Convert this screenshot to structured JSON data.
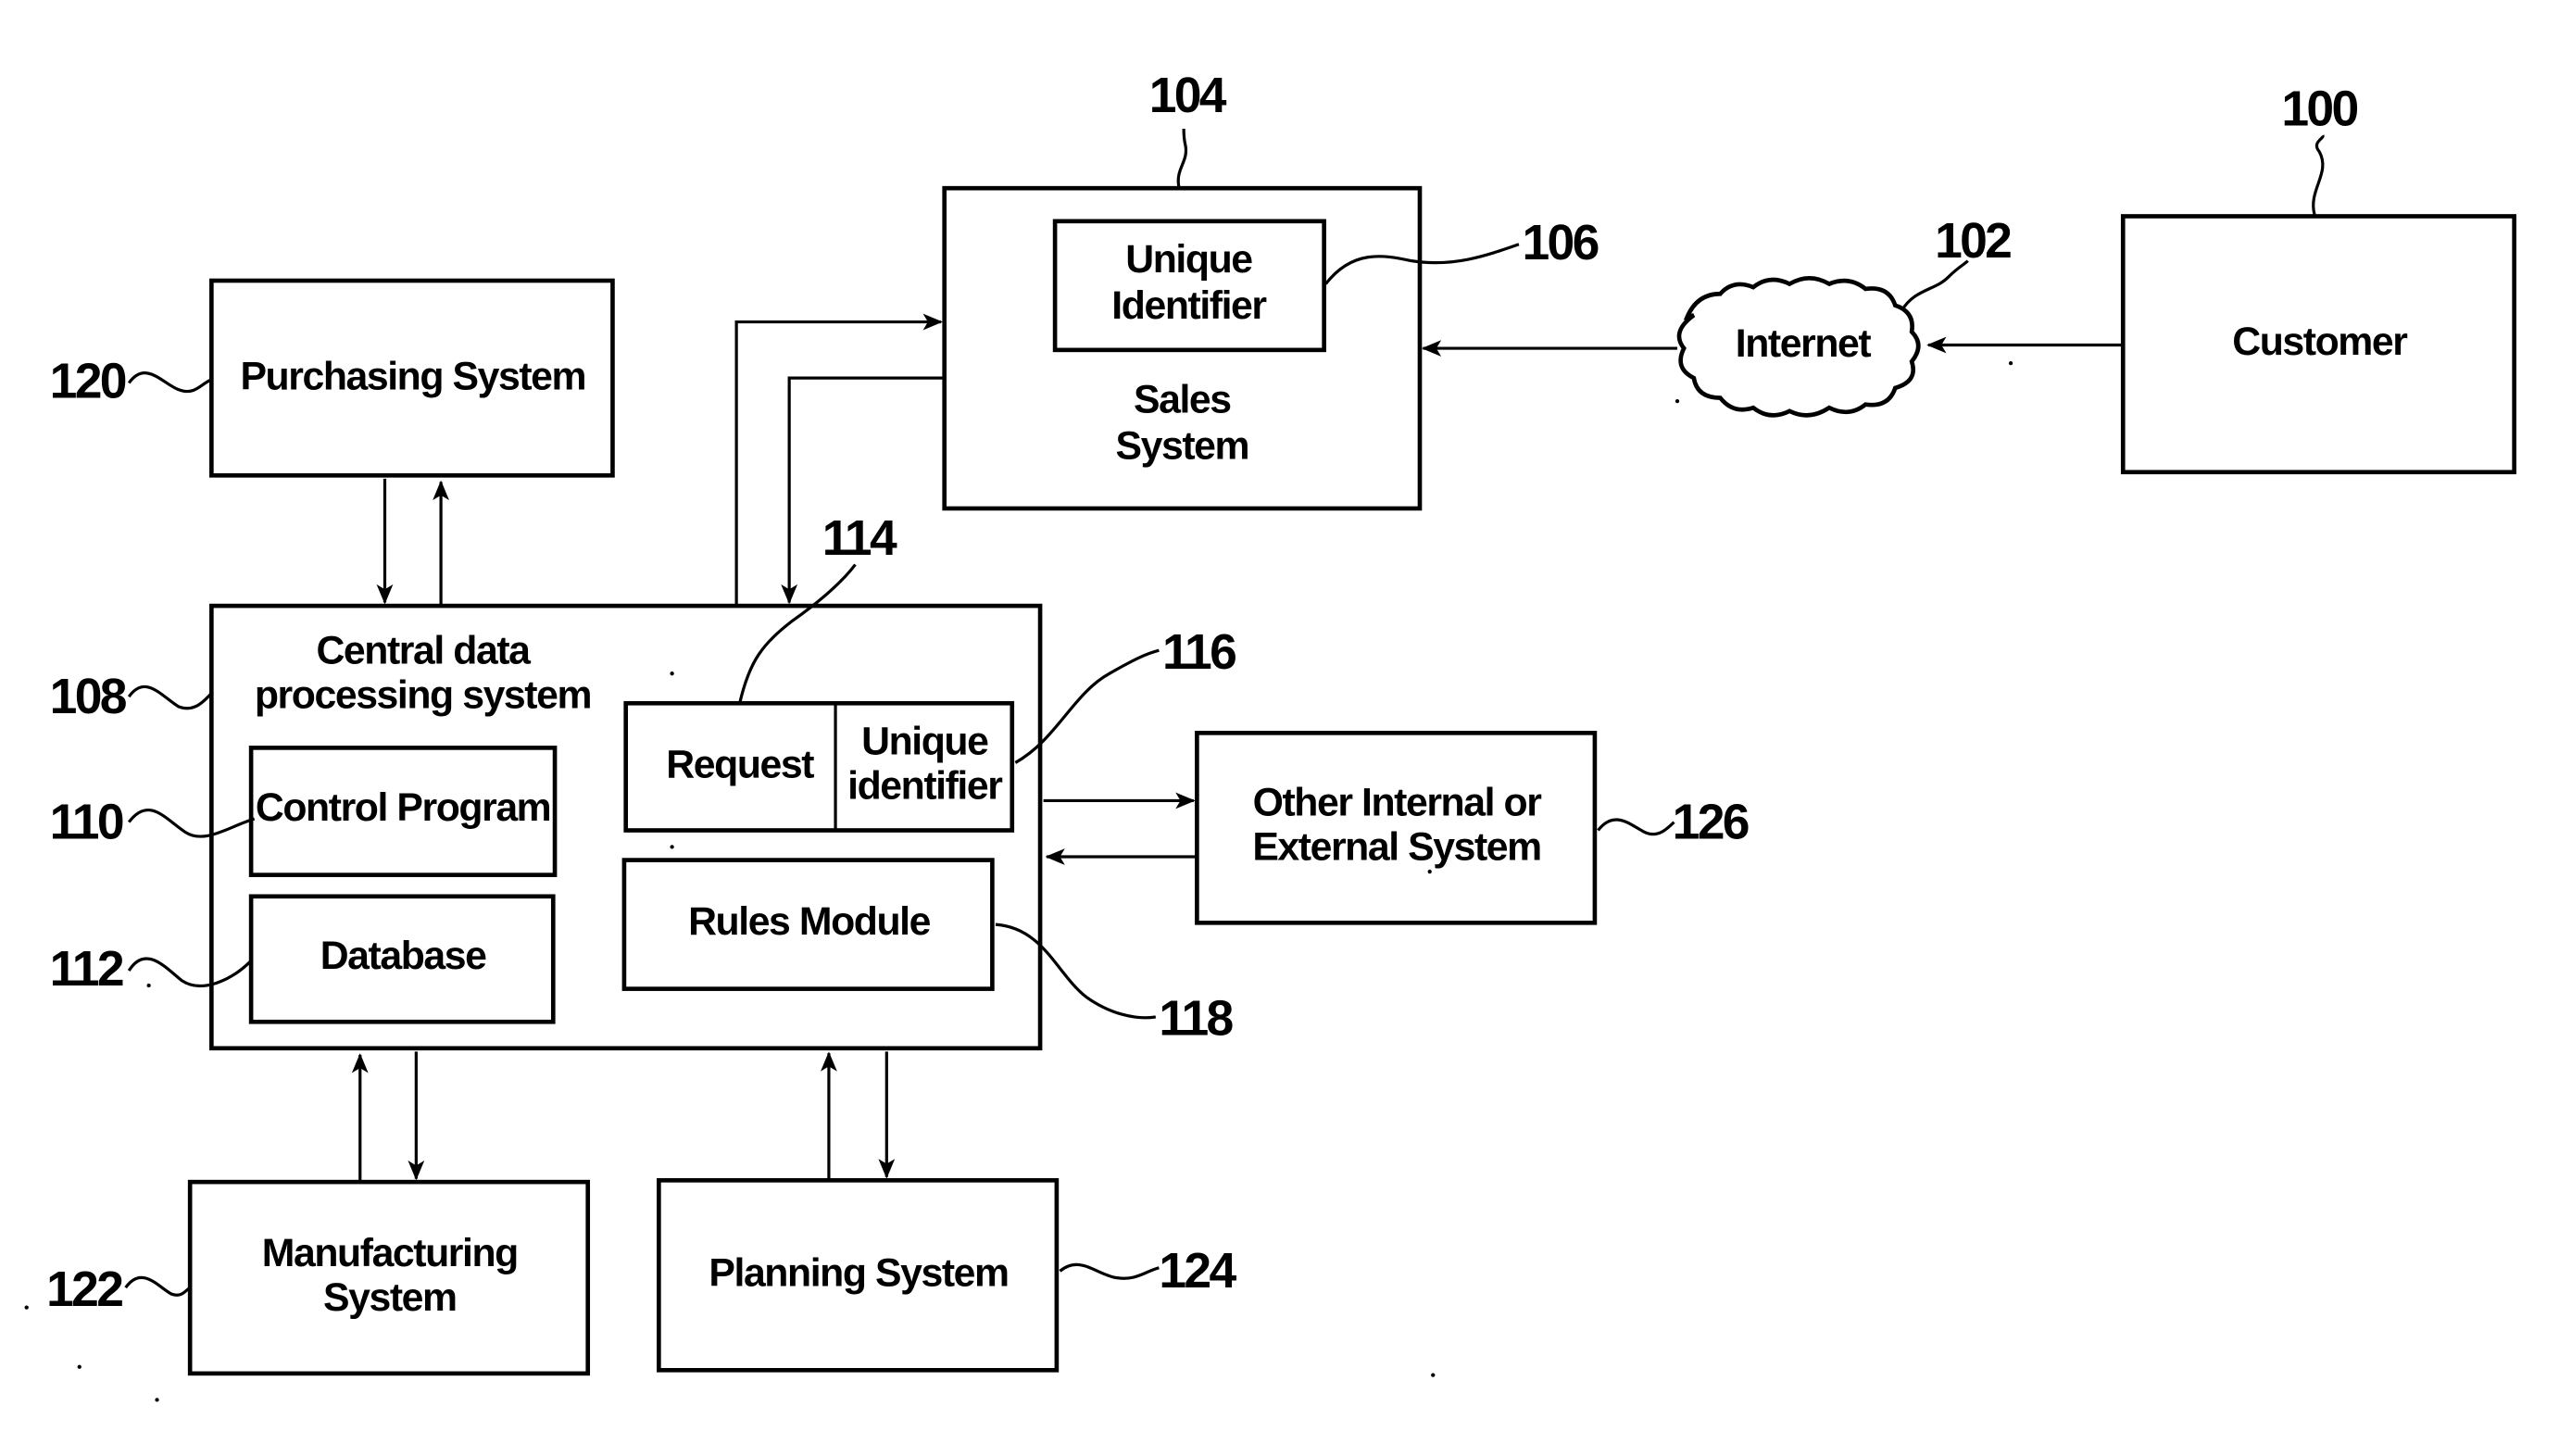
{
  "figure": {
    "blocks": {
      "customer": {
        "ref": "100",
        "label": [
          "Customer"
        ]
      },
      "internet": {
        "ref": "102",
        "label": [
          "Internet"
        ]
      },
      "sales_system": {
        "ref": "104",
        "label": [
          "Sales",
          "System"
        ]
      },
      "sales_unique_identifier": {
        "ref": "106",
        "label": [
          "Unique",
          "Identifier"
        ]
      },
      "central_system": {
        "ref": "108",
        "label": [
          "Central data",
          "processing system"
        ]
      },
      "control_program": {
        "ref": "110",
        "label": [
          "Control Program"
        ]
      },
      "database": {
        "ref": "112",
        "label": [
          "Database"
        ]
      },
      "request": {
        "ref": "114",
        "label": [
          "Request"
        ]
      },
      "request_unique_identifier": {
        "ref": "116",
        "label": [
          "Unique",
          "identifier"
        ]
      },
      "rules_module": {
        "ref": "118",
        "label": [
          "Rules Module"
        ]
      },
      "purchasing_system": {
        "ref": "120",
        "label": [
          "Purchasing System"
        ]
      },
      "manufacturing_system": {
        "ref": "122",
        "label": [
          "Manufacturing",
          "System"
        ]
      },
      "planning_system": {
        "ref": "124",
        "label": [
          "Planning System"
        ]
      },
      "other_system": {
        "ref": "126",
        "label": [
          "Other Internal or",
          "External System"
        ]
      }
    },
    "connections": [
      {
        "from": "customer",
        "to": "internet"
      },
      {
        "from": "internet",
        "to": "sales_system"
      },
      {
        "from": "central_system",
        "to": "sales_system"
      },
      {
        "from": "sales_system",
        "to": "central_system"
      },
      {
        "from": "purchasing_system",
        "to": "central_system"
      },
      {
        "from": "central_system",
        "to": "purchasing_system"
      },
      {
        "from": "central_system",
        "to": "other_system"
      },
      {
        "from": "other_system",
        "to": "central_system"
      },
      {
        "from": "central_system",
        "to": "manufacturing_system"
      },
      {
        "from": "manufacturing_system",
        "to": "central_system"
      },
      {
        "from": "central_system",
        "to": "planning_system"
      },
      {
        "from": "planning_system",
        "to": "central_system"
      }
    ]
  }
}
